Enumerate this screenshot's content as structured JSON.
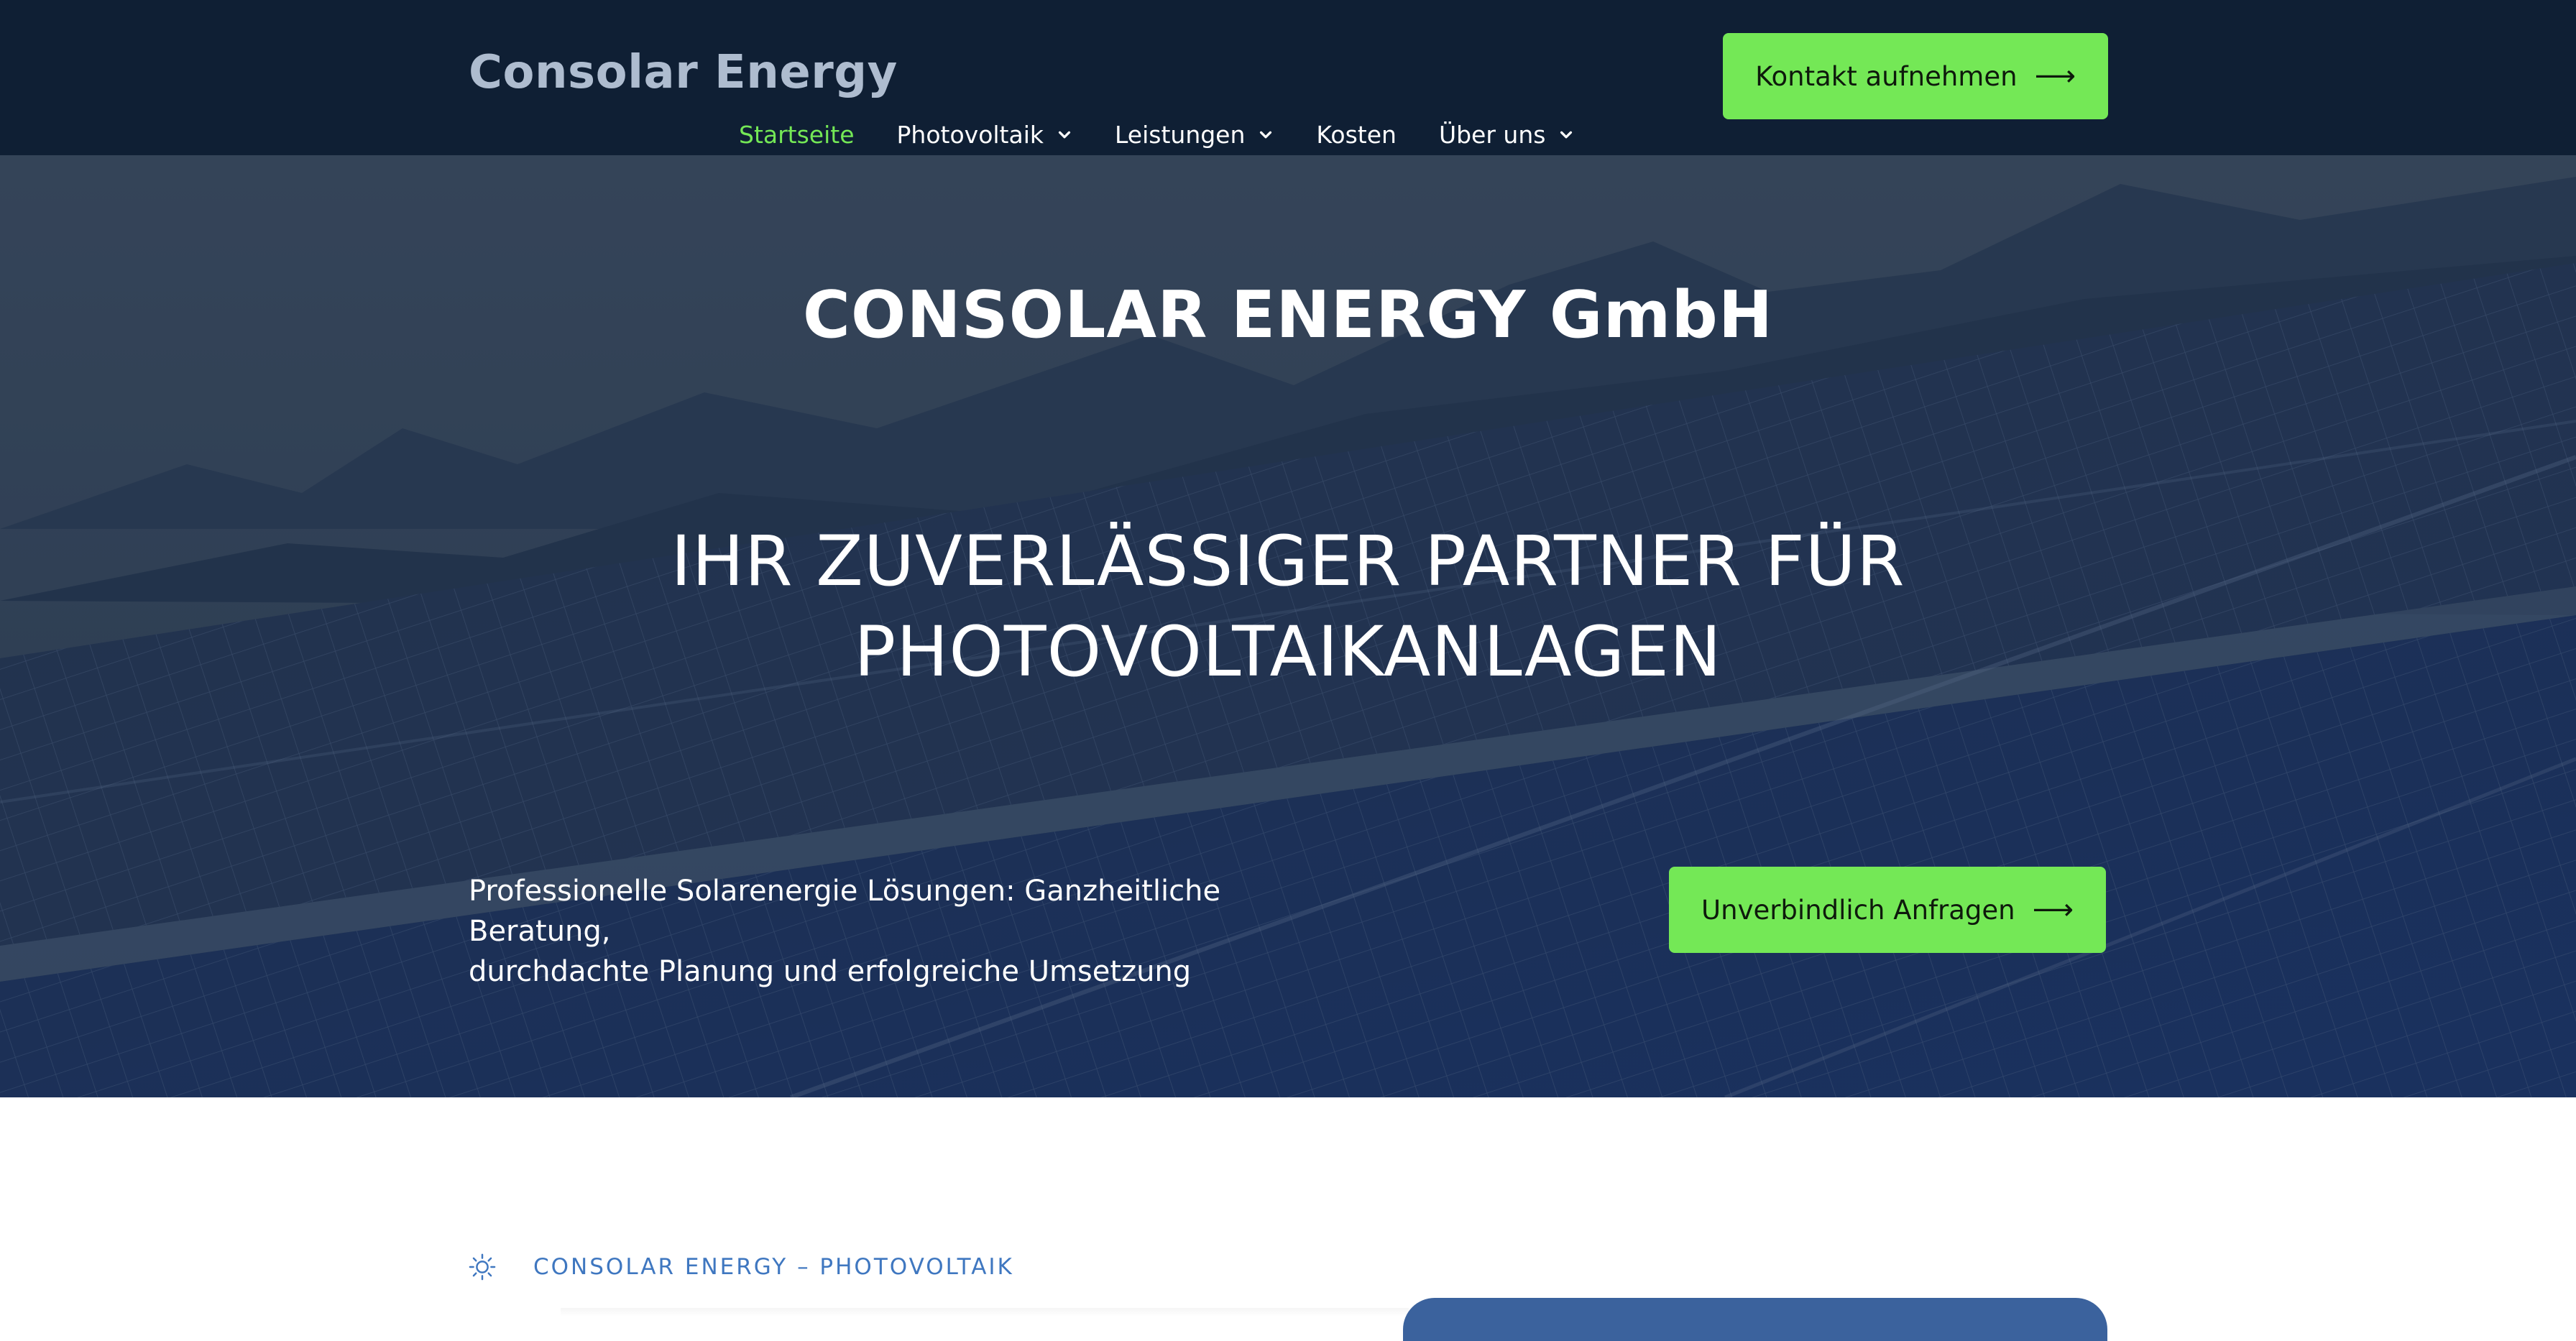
{
  "header": {
    "logo": "Consolar Energy",
    "cta_label": "Kontakt aufnehmen",
    "cta_icon": "arrow-right-icon",
    "nav": [
      {
        "label": "Startseite",
        "active": true,
        "has_dropdown": false
      },
      {
        "label": "Photovoltaik",
        "active": false,
        "has_dropdown": true
      },
      {
        "label": "Leistungen",
        "active": false,
        "has_dropdown": true
      },
      {
        "label": "Kosten",
        "active": false,
        "has_dropdown": false
      },
      {
        "label": "Über uns",
        "active": false,
        "has_dropdown": true
      }
    ]
  },
  "hero": {
    "company": "CONSOLAR ENERGY GmbH",
    "title_line1": "IHR ZUVERLÄSSIGER PARTNER FÜR",
    "title_line2": "PHOTOVOLTAIKANLAGEN",
    "subtitle_line1": "Professionelle Solarenergie Lösungen: Ganzheitliche Beratung,",
    "subtitle_line2": "durchdachte Planung und erfolgreiche Umsetzung",
    "cta_label": "Unverbindlich Anfragen",
    "cta_icon": "arrow-right-icon",
    "background": "solar-panels-photo"
  },
  "section": {
    "icon": "sun-icon",
    "label": "CONSOLAR ENERGY – PHOTOVOLTAIK"
  },
  "colors": {
    "header_bg": "#0f1f34",
    "accent_green": "#74e856",
    "label_blue": "#3f77c0",
    "card_blue": "#3b629d"
  }
}
